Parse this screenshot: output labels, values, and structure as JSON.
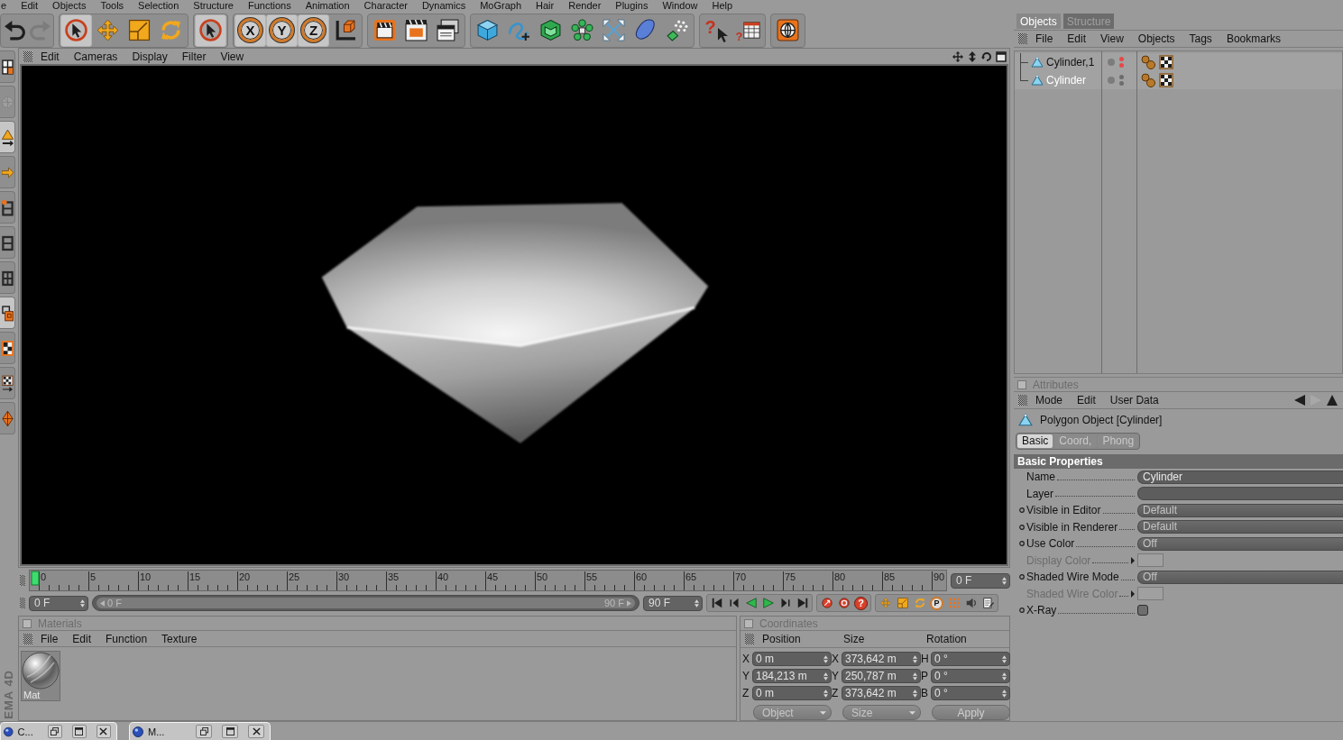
{
  "menu_bar": {
    "items": [
      "e",
      "Edit",
      "Objects",
      "Tools",
      "Selection",
      "Structure",
      "Functions",
      "Animation",
      "Character",
      "Dynamics",
      "MoGraph",
      "Hair",
      "Render",
      "Plugins",
      "Window",
      "Help"
    ]
  },
  "toolbar": {
    "groups": [
      [
        {
          "kind": "undo",
          "active": false,
          "disabled": false
        },
        {
          "kind": "redo",
          "active": false,
          "disabled": true
        }
      ],
      [
        {
          "kind": "liveselect",
          "active": true,
          "disabled": false
        },
        {
          "kind": "move",
          "active": false,
          "disabled": false
        },
        {
          "kind": "scale",
          "active": false,
          "disabled": false
        },
        {
          "kind": "rotate",
          "active": false,
          "disabled": false
        }
      ],
      [
        {
          "kind": "select",
          "active": true,
          "disabled": false
        }
      ],
      [
        {
          "kind": "axis",
          "label": "X",
          "active": true,
          "disabled": false
        },
        {
          "kind": "axis",
          "label": "Y",
          "active": true,
          "disabled": false
        },
        {
          "kind": "axis",
          "label": "Z",
          "active": true,
          "disabled": false
        },
        {
          "kind": "coords",
          "active": false,
          "disabled": false
        }
      ],
      [
        {
          "kind": "renderview",
          "active": false,
          "disabled": false
        },
        {
          "kind": "renderactive",
          "active": false,
          "disabled": false
        },
        {
          "kind": "rendersettings",
          "active": false,
          "disabled": false
        }
      ],
      [
        {
          "kind": "cube",
          "active": false,
          "disabled": false
        },
        {
          "kind": "spline",
          "active": false,
          "disabled": false
        },
        {
          "kind": "nurbs",
          "active": false,
          "disabled": false
        },
        {
          "kind": "cloner",
          "active": false,
          "disabled": false
        },
        {
          "kind": "deformer",
          "active": false,
          "disabled": false
        },
        {
          "kind": "environment",
          "active": false,
          "disabled": false
        },
        {
          "kind": "particles",
          "active": false,
          "disabled": false
        }
      ],
      [
        {
          "kind": "help",
          "label": "?",
          "active": false,
          "disabled": false
        },
        {
          "kind": "timeline",
          "label": "?",
          "active": false,
          "disabled": false
        }
      ],
      [
        {
          "kind": "browser",
          "active": false,
          "disabled": false
        }
      ]
    ]
  },
  "left_toolbar": {
    "tools": [
      {
        "kind": "model",
        "active": false,
        "disabled": false
      },
      {
        "kind": "texture",
        "active": false,
        "disabled": true
      },
      {
        "kind": "object",
        "active": true,
        "disabled": false
      },
      {
        "kind": "axis",
        "active": false,
        "disabled": false
      },
      {
        "kind": "points",
        "active": false,
        "disabled": false
      },
      {
        "kind": "edges",
        "active": false,
        "disabled": false
      },
      {
        "kind": "polygons",
        "active": false,
        "disabled": false
      },
      {
        "kind": "uv",
        "active": true,
        "disabled": false
      },
      {
        "kind": "texturemode",
        "active": false,
        "disabled": false
      },
      {
        "kind": "textureaxis",
        "active": false,
        "disabled": false
      },
      {
        "kind": "figure",
        "active": false,
        "disabled": false
      }
    ]
  },
  "side_label": "EMA 4D",
  "viewport": {
    "menu": [
      "Edit",
      "Cameras",
      "Display",
      "Filter",
      "View"
    ]
  },
  "timeline": {
    "ticks": [
      "0",
      "5",
      "10",
      "15",
      "20",
      "25",
      "30",
      "35",
      "40",
      "45",
      "50",
      "55",
      "60",
      "65",
      "70",
      "75",
      "80",
      "85",
      "90"
    ],
    "level": 0,
    "frame_field": "0 F"
  },
  "transport": {
    "start_field": "0 F",
    "range": {
      "start": "0 F",
      "end": "90 F",
      "level": 1
    },
    "end_field": "90 F",
    "groups": [
      [
        {
          "kind": "first"
        },
        {
          "kind": "prevkey"
        },
        {
          "kind": "playback"
        },
        {
          "kind": "play"
        },
        {
          "kind": "nextkey"
        },
        {
          "kind": "last"
        }
      ],
      [
        {
          "kind": "record"
        },
        {
          "kind": "autokey"
        },
        {
          "kind": "keyhelp",
          "label": "?"
        }
      ],
      [
        {
          "kind": "keymove"
        },
        {
          "kind": "keyscale"
        },
        {
          "kind": "keyrotate"
        },
        {
          "kind": "keyparam",
          "label": "P"
        },
        {
          "kind": "keypoints"
        },
        {
          "kind": "sound"
        },
        {
          "kind": "sheet"
        }
      ]
    ]
  },
  "materials": {
    "title": "Materials",
    "menu": [
      "File",
      "Edit",
      "Function",
      "Texture"
    ],
    "items": [
      {
        "name": "Mat"
      }
    ]
  },
  "coordinates": {
    "title": "Coordinates",
    "columns": [
      "Position",
      "Size",
      "Rotation"
    ],
    "rows": [
      [
        {
          "axis": "X",
          "value": "0 m"
        },
        {
          "axis": "X",
          "value": "373,642 m"
        },
        {
          "axis": "H",
          "value": "0 °"
        }
      ],
      [
        {
          "axis": "Y",
          "value": "184,213 m"
        },
        {
          "axis": "Y",
          "value": "250,787 m"
        },
        {
          "axis": "P",
          "value": "0 °"
        }
      ],
      [
        {
          "axis": "Z",
          "value": "0 m"
        },
        {
          "axis": "Z",
          "value": "373,642 m"
        },
        {
          "axis": "B",
          "value": "0 °"
        }
      ]
    ],
    "controls": [
      {
        "kind": "dropdown",
        "label": "Object"
      },
      {
        "kind": "dropdown",
        "label": "Size"
      },
      {
        "kind": "button",
        "label": "Apply"
      }
    ]
  },
  "objects_panel": {
    "tabs": [
      {
        "label": "Objects",
        "selected": true
      },
      {
        "label": "Structure",
        "selected": false
      }
    ],
    "menu": [
      "File",
      "Edit",
      "View",
      "Objects",
      "Tags",
      "Bookmarks"
    ],
    "objects": [
      {
        "name": "Cylinder,1",
        "selected": false,
        "hidden": true
      },
      {
        "name": "Cylinder",
        "selected": true,
        "hidden": false
      }
    ]
  },
  "attributes": {
    "title": "Attributes",
    "menu": [
      "Mode",
      "Edit",
      "User Data"
    ],
    "object_title": "Polygon Object [Cylinder]",
    "tabs": [
      {
        "label": "Basic",
        "selected": true
      },
      {
        "label": "Coord,",
        "selected": false
      },
      {
        "label": "Phong",
        "selected": false
      }
    ],
    "section": "Basic Properties",
    "properties": [
      {
        "label": "Name",
        "kind": "text",
        "value": "Cylinder",
        "animatable": false,
        "disabled": false
      },
      {
        "label": "Layer",
        "kind": "layer",
        "animatable": false,
        "disabled": false
      },
      {
        "label": "Visible in Editor",
        "kind": "dropdown",
        "value": "Default",
        "animatable": true,
        "disabled": false
      },
      {
        "label": "Visible in Renderer",
        "kind": "dropdown",
        "value": "Default",
        "animatable": true,
        "disabled": false
      },
      {
        "label": "Use Color",
        "kind": "dropdown",
        "value": "Off",
        "animatable": true,
        "disabled": false
      },
      {
        "label": "Display Color",
        "kind": "color",
        "animatable": false,
        "disabled": true
      },
      {
        "label": "Shaded Wire Mode",
        "kind": "dropdown",
        "value": "Off",
        "animatable": true,
        "disabled": false
      },
      {
        "label": "Shaded Wire Color",
        "kind": "color",
        "animatable": false,
        "disabled": true
      },
      {
        "label": "X-Ray",
        "kind": "checkbox",
        "checked": false,
        "animatable": true,
        "disabled": false
      }
    ]
  },
  "taskbar": {
    "windows": [
      {
        "title": "C..."
      },
      {
        "title": "M..."
      }
    ]
  }
}
